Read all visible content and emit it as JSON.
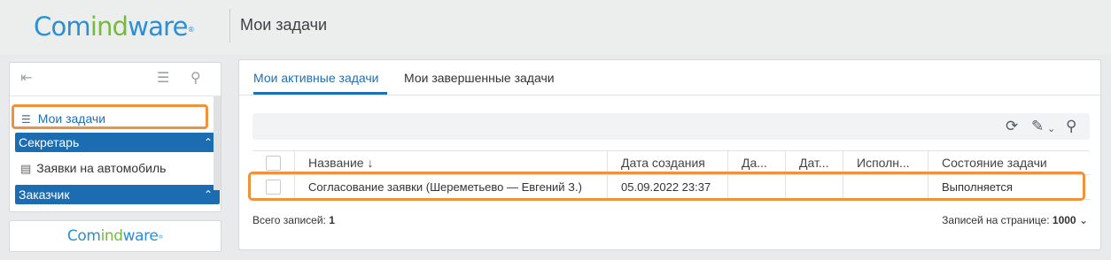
{
  "header": {
    "logo": {
      "part1": "Com",
      "part2": "ind",
      "part3": "ware",
      "mark": "®"
    },
    "page_title": "Мои задачи"
  },
  "sidebar": {
    "active_item": "Мои задачи",
    "groups": [
      {
        "label": "Секретарь",
        "items": [
          "Заявки на автомобиль"
        ]
      },
      {
        "label": "Заказчик",
        "items": []
      }
    ],
    "bottom_logo": {
      "part1": "Com",
      "part2": "ind",
      "part3": "ware",
      "mark": "®"
    }
  },
  "main": {
    "tabs": [
      {
        "label": "Мои активные задачи",
        "active": true
      },
      {
        "label": "Мои завершенные задачи",
        "active": false
      }
    ],
    "table": {
      "columns": [
        "Название ↓",
        "Дата создания",
        "Да...",
        "Дат...",
        "Исполн...",
        "Состояние задачи"
      ],
      "rows": [
        [
          "Согласование заявки (Шереметьево — Евгений З.)",
          "05.09.2022 23:37",
          "",
          "",
          "",
          "Выполняется"
        ]
      ]
    },
    "footer": {
      "total_label": "Всего записей:",
      "total_value": "1",
      "per_page_label": "Записей на странице:",
      "per_page_value": "1000"
    }
  },
  "colors": {
    "accent": "#1f6fb3",
    "highlight": "#f0923c",
    "group_bg": "#1b6cb0",
    "logo_blue": "#2b8fd6",
    "logo_green": "#78b843"
  },
  "icons": [
    "collapse-icon",
    "list-icon",
    "search-icon",
    "refresh-icon",
    "edit-icon",
    "chevron-down-icon",
    "chevron-up-icon"
  ]
}
